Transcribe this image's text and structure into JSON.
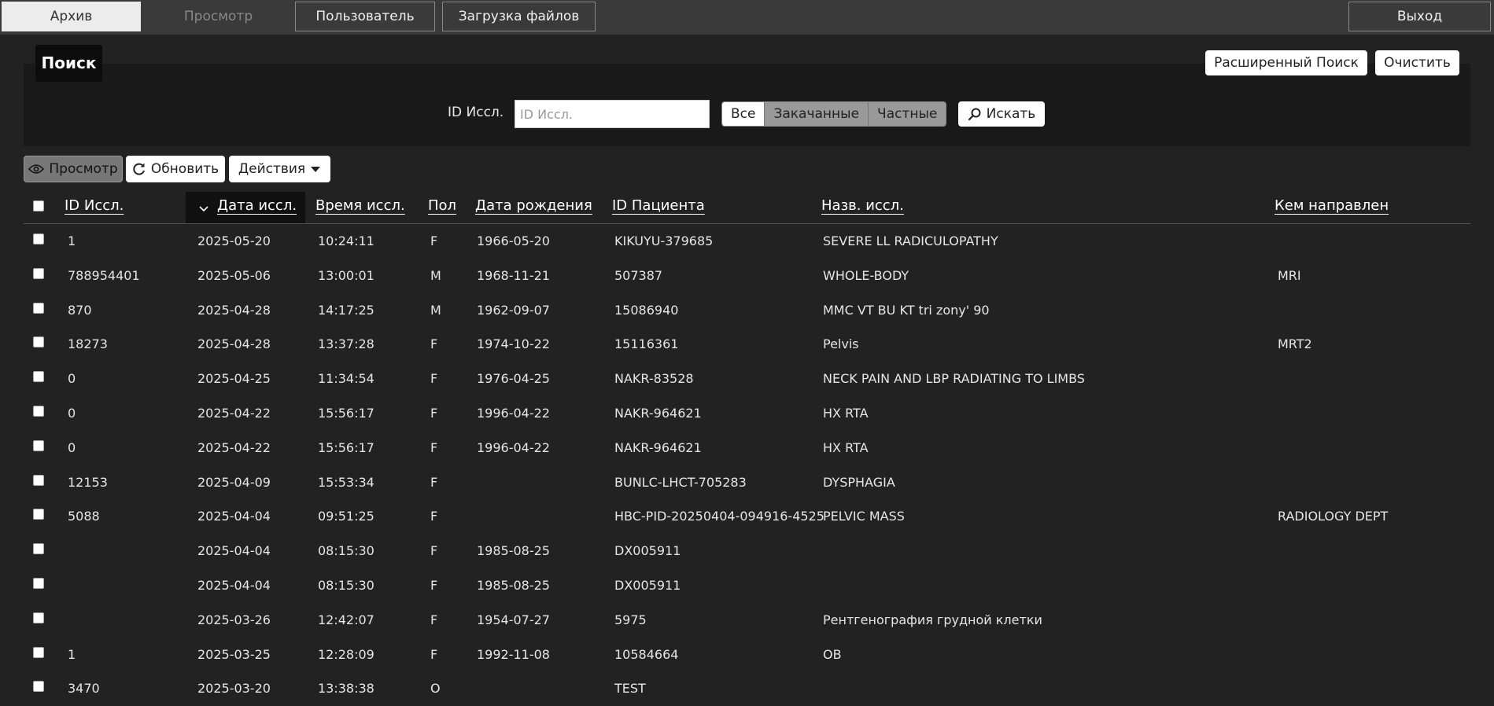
{
  "nav": {
    "archive": "Архив",
    "view": "Просмотр",
    "user": "Пользователь",
    "upload": "Загрузка файлов",
    "logout": "Выход"
  },
  "search": {
    "title": "Поиск",
    "advanced": "Расширенный Поиск",
    "clear": "Очистить",
    "id_label": "ID Иссл.",
    "id_placeholder": "ID Иссл.",
    "id_value": "",
    "filters": [
      "Все",
      "Закачанные",
      "Частные"
    ],
    "selected_filter": "Все",
    "search_button": "Искать"
  },
  "toolbar": {
    "view": "Просмотр",
    "refresh": "Обновить",
    "actions": "Действия"
  },
  "table": {
    "columns": [
      "ID Иссл.",
      "Дата иссл.",
      "Время иссл.",
      "Пол",
      "Дата рождения",
      "ID Пациента",
      "Назв. иссл.",
      "Кем направлен"
    ],
    "sorted_column": "Дата иссл.",
    "sort_direction": "descending",
    "rows": [
      [
        "1",
        "2025-05-20",
        "10:24:11",
        "F",
        "1966-05-20",
        "KIKUYU-379685",
        "SEVERE LL RADICULOPATHY",
        ""
      ],
      [
        "788954401",
        "2025-05-06",
        "13:00:01",
        "M",
        "1968-11-21",
        "507387",
        "WHOLE-BODY",
        "MRI"
      ],
      [
        "870",
        "2025-04-28",
        "14:17:25",
        "M",
        "1962-09-07",
        "15086940",
        "MMC VT BU KT tri zony' 90",
        ""
      ],
      [
        "18273",
        "2025-04-28",
        "13:37:28",
        "F",
        "1974-10-22",
        "15116361",
        "Pelvis",
        "MRT2"
      ],
      [
        "0",
        "2025-04-25",
        "11:34:54",
        "F",
        "1976-04-25",
        "NAKR-83528",
        "NECK PAIN AND LBP RADIATING TO LIMBS",
        ""
      ],
      [
        "0",
        "2025-04-22",
        "15:56:17",
        "F",
        "1996-04-22",
        "NAKR-964621",
        "HX RTA",
        ""
      ],
      [
        "0",
        "2025-04-22",
        "15:56:17",
        "F",
        "1996-04-22",
        "NAKR-964621",
        "HX RTA",
        ""
      ],
      [
        "12153",
        "2025-04-09",
        "15:53:34",
        "F",
        "",
        "BUNLC-LHCT-705283",
        "DYSPHAGIA",
        ""
      ],
      [
        "5088",
        "2025-04-04",
        "09:51:25",
        "F",
        "",
        "HBC-PID-20250404-094916-4525",
        "PELVIC MASS",
        "RADIOLOGY DEPT"
      ],
      [
        "",
        "2025-04-04",
        "08:15:30",
        "F",
        "1985-08-25",
        "DX005911",
        "",
        ""
      ],
      [
        "",
        "2025-04-04",
        "08:15:30",
        "F",
        "1985-08-25",
        "DX005911",
        "",
        ""
      ],
      [
        "",
        "2025-03-26",
        "12:42:07",
        "F",
        "1954-07-27",
        "5975",
        "Рентгенография грудной клетки",
        ""
      ],
      [
        "1",
        "2025-03-25",
        "12:28:09",
        "F",
        "1992-11-08",
        "10584664",
        "OB",
        ""
      ],
      [
        "3470",
        "2025-03-20",
        "13:38:38",
        "O",
        "",
        "TEST",
        "",
        ""
      ]
    ]
  }
}
